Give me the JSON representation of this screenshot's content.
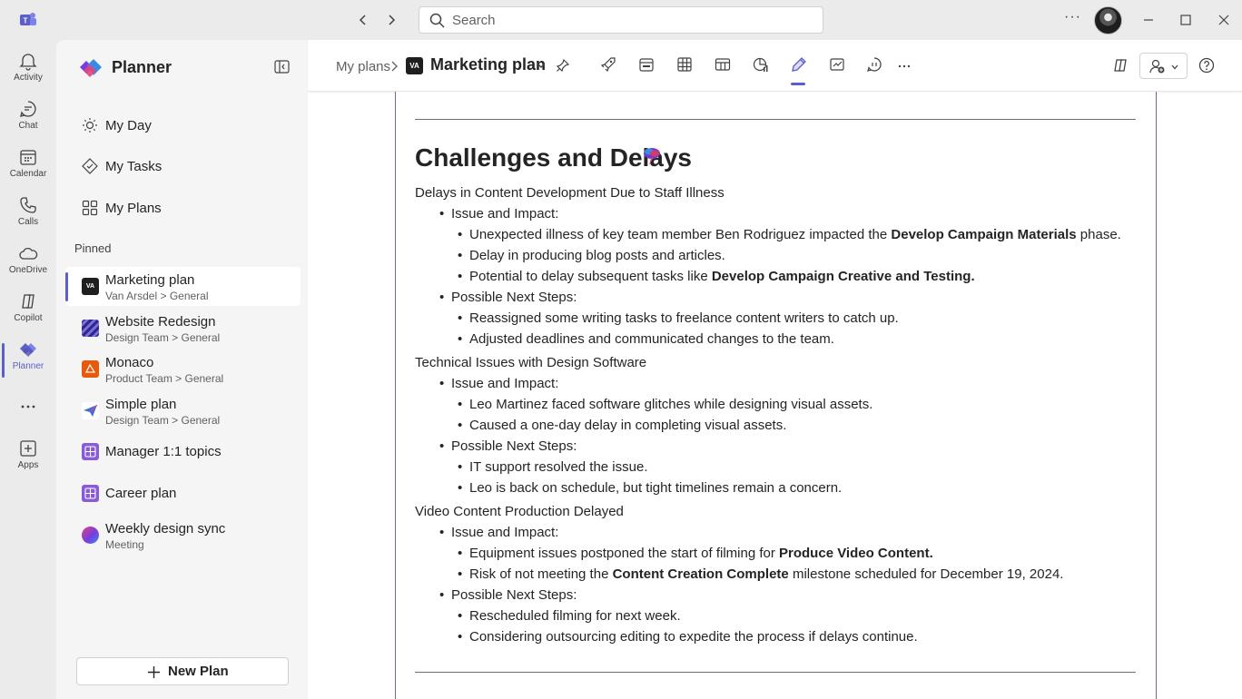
{
  "titlebar": {
    "search_placeholder": "Search",
    "more": "···"
  },
  "rail": {
    "items": [
      {
        "label": "Activity",
        "icon": "bell-icon"
      },
      {
        "label": "Chat",
        "icon": "chat-icon"
      },
      {
        "label": "Calendar",
        "icon": "calendar-icon"
      },
      {
        "label": "Calls",
        "icon": "phone-icon"
      },
      {
        "label": "OneDrive",
        "icon": "cloud-icon"
      },
      {
        "label": "Copilot",
        "icon": "copilot-icon"
      },
      {
        "label": "Planner",
        "icon": "planner-icon",
        "active": true
      },
      {
        "label": "",
        "icon": "more-icon"
      },
      {
        "label": "Apps",
        "icon": "add-app-icon"
      }
    ]
  },
  "panel": {
    "title": "Planner",
    "nav": [
      {
        "label": "My Day",
        "icon": "sun-icon"
      },
      {
        "label": "My Tasks",
        "icon": "tasks-icon"
      },
      {
        "label": "My Plans",
        "icon": "grid-icon"
      }
    ],
    "pinned_label": "Pinned",
    "plans": [
      {
        "name": "Marketing plan",
        "sub": "Van Arsdel  > General",
        "selected": true
      },
      {
        "name": "Website Redesign",
        "sub": "Design Team > General"
      },
      {
        "name": "Monaco",
        "sub": "Product Team > General"
      },
      {
        "name": "Simple plan",
        "sub": "Design Team > General"
      },
      {
        "name": "Manager 1:1 topics",
        "sub": ""
      },
      {
        "name": "Career plan",
        "sub": ""
      },
      {
        "name": "Weekly design sync",
        "sub": "Meeting"
      }
    ],
    "new_plan": "New Plan"
  },
  "header": {
    "breadcrumb": "My plans",
    "plan_title": "Marketing plan",
    "plan_badge": "VA"
  },
  "document": {
    "title": "Challenges and Delays",
    "sections": [
      {
        "heading": "Delays in Content Development Due to Staff Illness"
      },
      {
        "issue": "Issue and Impact:"
      },
      {
        "p1_a": "Unexpected illness of key team member Ben Rodriguez impacted the ",
        "p1_b": "Develop Campaign Materials",
        "p1_c": " phase."
      },
      {
        "p2": "Delay in producing blog posts and articles."
      },
      {
        "p3_a": "Potential to delay subsequent tasks like ",
        "p3_b": "Develop Campaign Creative and Testing."
      }
    ],
    "s1": {
      "heading": "Delays in Content Development Due to Staff Illness",
      "issue": "Issue and Impact:",
      "i1a": "Unexpected illness of key team member Ben Rodriguez impacted the ",
      "i1b": "Develop Campaign Materials",
      "i1c": " phase.",
      "i2": "Delay in producing blog posts and articles.",
      "i3a": "Potential to delay subsequent tasks like ",
      "i3b": "Develop Campaign Creative and Testing.",
      "next": "Possible Next Steps:",
      "n1": "Reassigned some writing tasks to freelance content writers to catch up.",
      "n2": "Adjusted deadlines and communicated changes to the team."
    },
    "s2": {
      "heading": "Technical Issues with Design Software",
      "issue": "Issue and Impact:",
      "i1": "Leo Martinez faced software glitches while designing visual assets.",
      "i2": "Caused a one-day delay in completing visual assets.",
      "next": "Possible Next Steps:",
      "n1": "IT support resolved the issue.",
      "n2": "Leo is back on schedule, but tight timelines remain a concern."
    },
    "s3": {
      "heading": "Video Content Production Delayed",
      "issue": "Issue and Impact:",
      "i1a": "Equipment issues postponed the start of filming for ",
      "i1b": "Produce Video Content.",
      "i2a": "Risk of not meeting the ",
      "i2b": "Content Creation Complete",
      "i2c": " milestone scheduled for December 19, 2024.",
      "next": "Possible Next Steps:",
      "n1": "Rescheduled filming for next week.",
      "n2": "Considering outsourcing editing to expedite the process if delays continue."
    }
  },
  "colors": {
    "accent": "#5b5fc7",
    "doc_border": "#8a5a9e"
  }
}
